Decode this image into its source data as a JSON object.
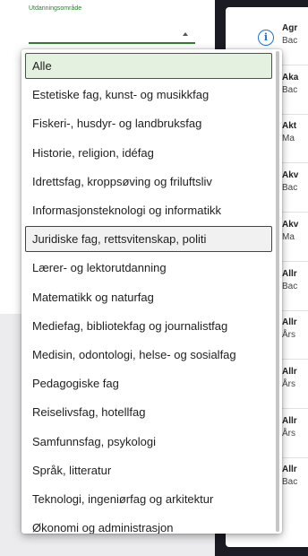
{
  "select": {
    "label": "Utdanningsområde",
    "value": ""
  },
  "dropdown": {
    "options": [
      "Alle",
      "Estetiske fag, kunst- og musikkfag",
      "Fiskeri-, husdyr- og landbruksfag",
      "Historie, religion, idéfag",
      "Idrettsfag, kroppsøving og friluftsliv",
      "Informasjonsteknologi og informatikk",
      "Juridiske fag, rettsvitenskap, politi",
      "Lærer- og lektorutdanning",
      "Matematikk og naturfag",
      "Mediefag, bibliotekfag og journalistfag",
      "Medisin, odontologi, helse- og sosialfag",
      "Pedagogiske fag",
      "Reiselivsfag, hotellfag",
      "Samfunnsfag, psykologi",
      "Språk, litteratur",
      "Teknologi, ingeniørfag og arkitektur",
      "Økonomi og administrasjon"
    ],
    "selected_index": 0,
    "hovered_index": 6
  },
  "results": {
    "items": [
      {
        "title": "Agr",
        "subtitle": "Bac"
      },
      {
        "title": "Aka",
        "subtitle": "Bac"
      },
      {
        "title": "Akt",
        "subtitle": "Ma"
      },
      {
        "title": "Akv",
        "subtitle": "Bac"
      },
      {
        "title": "Akv",
        "subtitle": "Ma"
      },
      {
        "title": "Allr",
        "subtitle": "Bac"
      },
      {
        "title": "Allr",
        "subtitle": "Års"
      },
      {
        "title": "Allr",
        "subtitle": "Års"
      },
      {
        "title": "Allr",
        "subtitle": "Års"
      },
      {
        "title": "Allr",
        "subtitle": "Bac"
      }
    ],
    "info_icon_glyph": "i",
    "icon": "info-icon"
  },
  "colors": {
    "accent_green": "#2e7d32",
    "info_blue": "#1976d2"
  }
}
